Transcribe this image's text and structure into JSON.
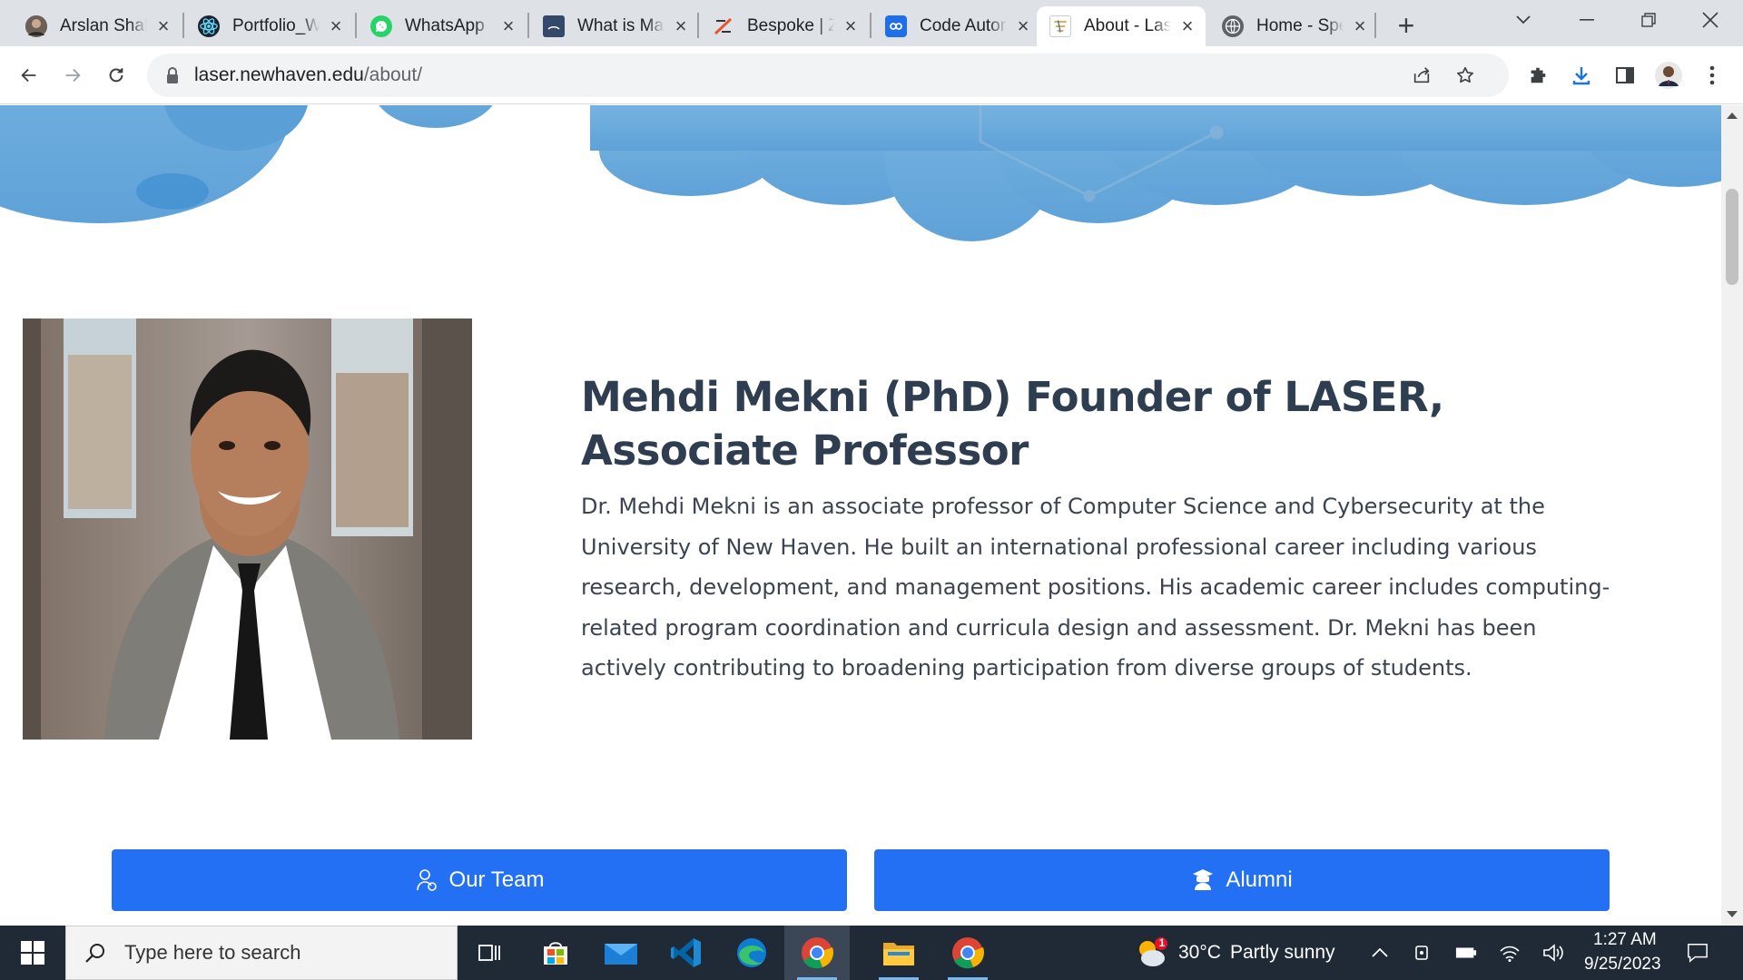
{
  "browser": {
    "tabs": [
      {
        "title": "Arslan Shah",
        "favicon": "profile-photo-icon",
        "active": false
      },
      {
        "title": "Portfolio_W",
        "favicon": "react-icon",
        "active": false
      },
      {
        "title": "WhatsApp",
        "favicon": "whatsapp-icon",
        "active": false
      },
      {
        "title": "What is Ma",
        "favicon": "document-icon",
        "active": false
      },
      {
        "title": "Bespoke | Z",
        "favicon": "bespoke-icon",
        "active": false
      },
      {
        "title": "Code Autor",
        "favicon": "copilot-icon",
        "active": false
      },
      {
        "title": "About - Las",
        "favicon": "laser-site-icon",
        "active": true
      },
      {
        "title": "Home - Spe",
        "favicon": "globe-icon",
        "active": false
      }
    ],
    "url": {
      "domain": "laser.newhaven.edu",
      "path": "/about/"
    }
  },
  "page": {
    "heading": "Mehdi Mekni (PhD) Founder of LASER, Associate Professor",
    "bio": "Dr. Mehdi Mekni is an associate professor of Computer Science and Cybersecurity at the University of New Haven. He built an international professional career including various research, development, and management positions. His academic career includes computing-related program coordination and curricula design and assessment. Dr. Mekni has been actively contributing to broadening participation from diverse groups of students.",
    "buttons": {
      "team": "Our Team",
      "alumni": "Alumni"
    }
  },
  "taskbar": {
    "search_placeholder": "Type here to search",
    "weather": {
      "temp": "30°C",
      "condition": "Partly sunny",
      "badge": "1"
    },
    "clock": {
      "time": "1:27 AM",
      "date": "9/25/2023"
    }
  },
  "colors": {
    "accent_button": "#2370f4",
    "heading": "#2e3d4f",
    "cloud": "#6fb0e0"
  }
}
